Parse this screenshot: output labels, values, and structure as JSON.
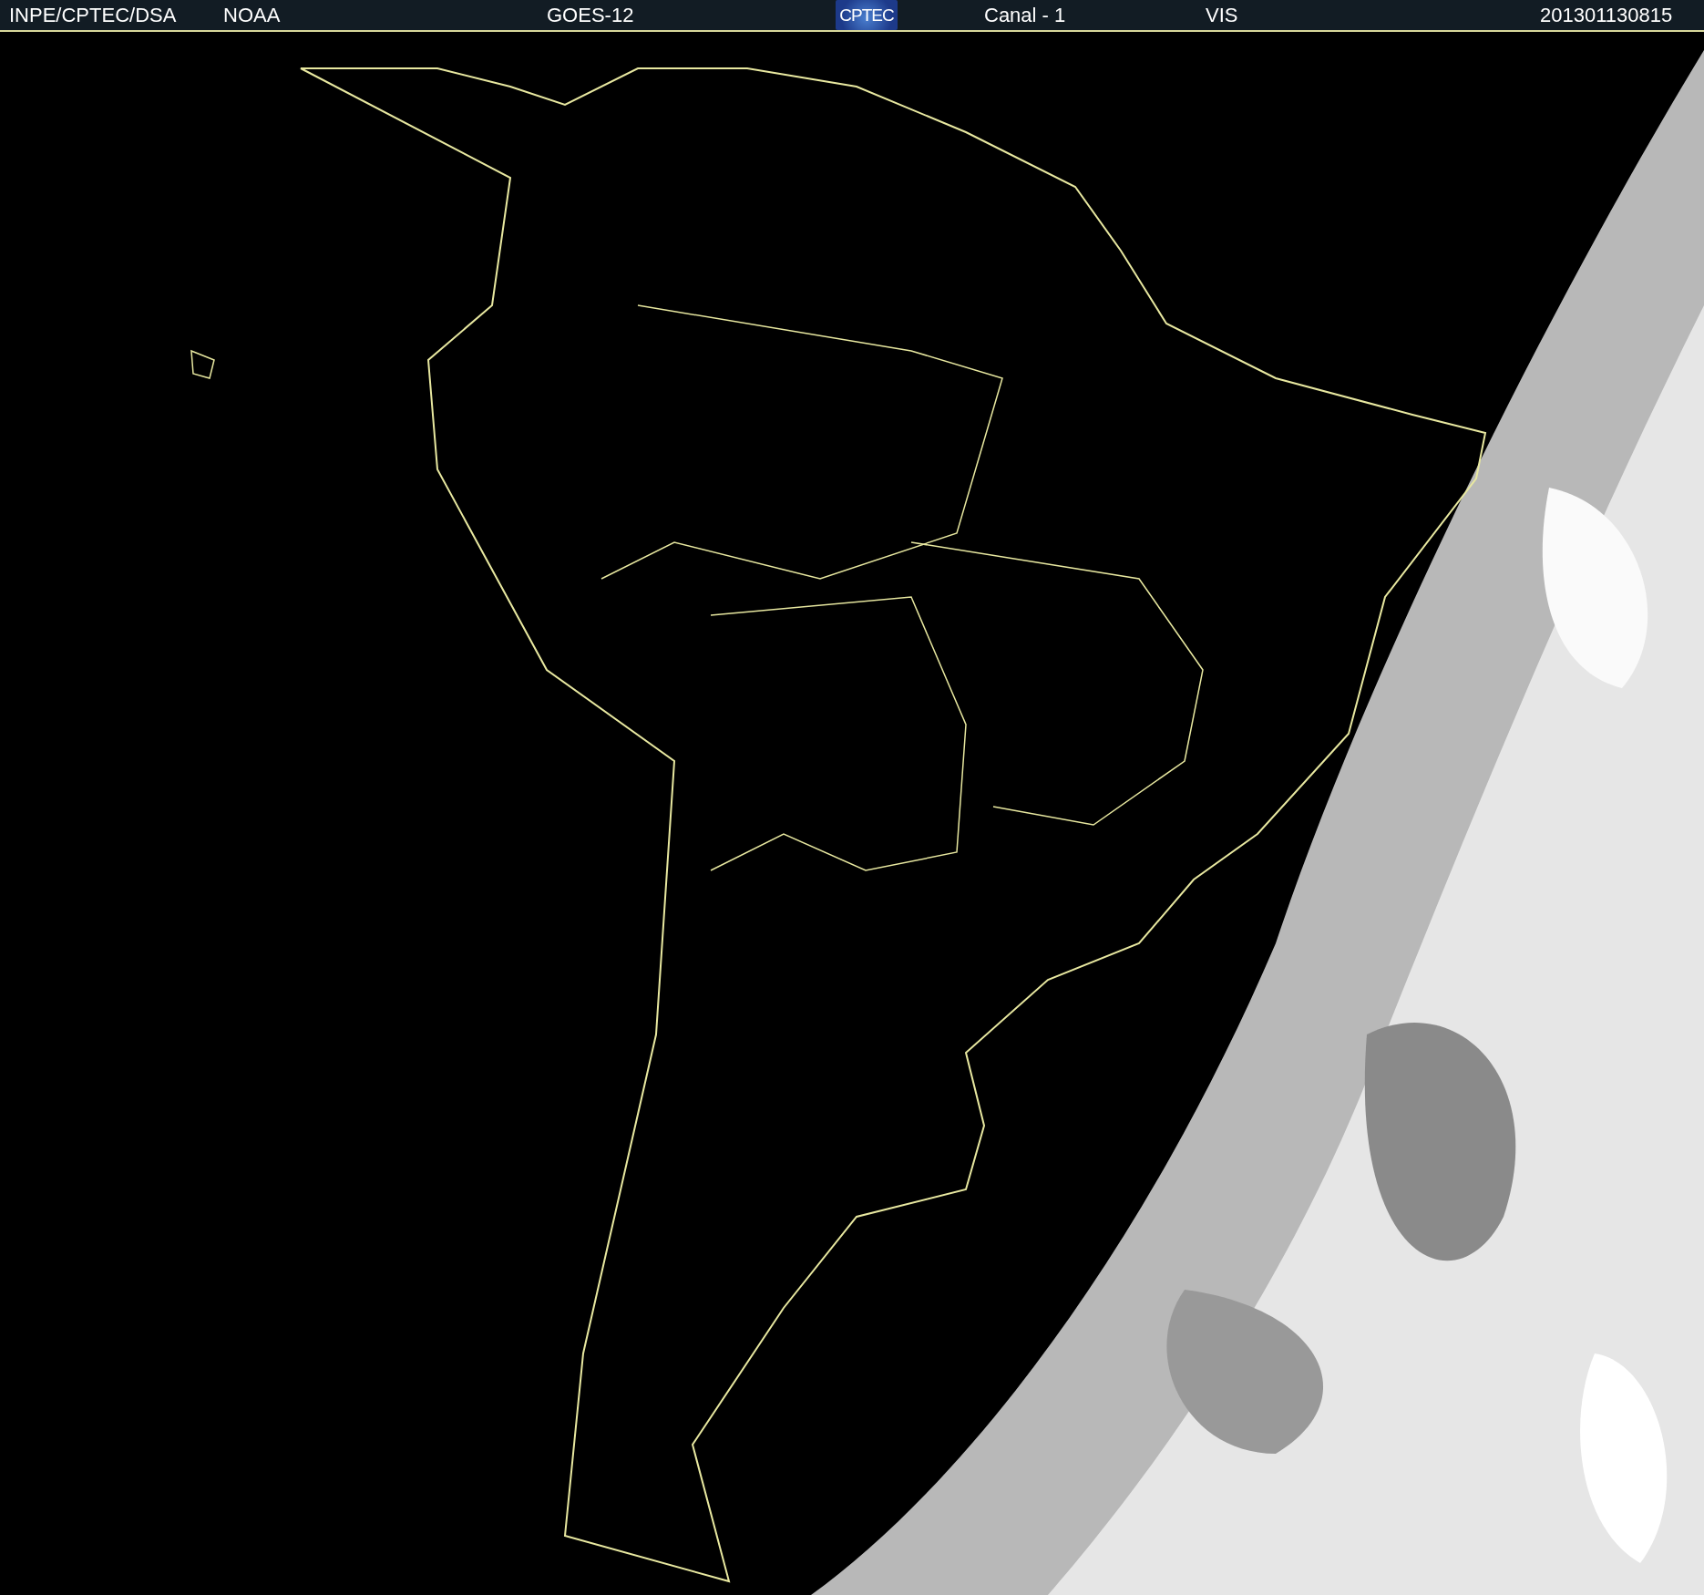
{
  "header": {
    "items": [
      {
        "kind": "label",
        "text": "INPE/CPTEC/DSA"
      },
      {
        "kind": "label",
        "text": "NOAA"
      },
      {
        "kind": "label",
        "text": "GOES-12"
      },
      {
        "kind": "logo",
        "text": "CPTEC"
      },
      {
        "kind": "label",
        "text": "Canal - 1"
      },
      {
        "kind": "label",
        "text": "VIS"
      },
      {
        "kind": "label",
        "text": "201301130815"
      }
    ]
  }
}
